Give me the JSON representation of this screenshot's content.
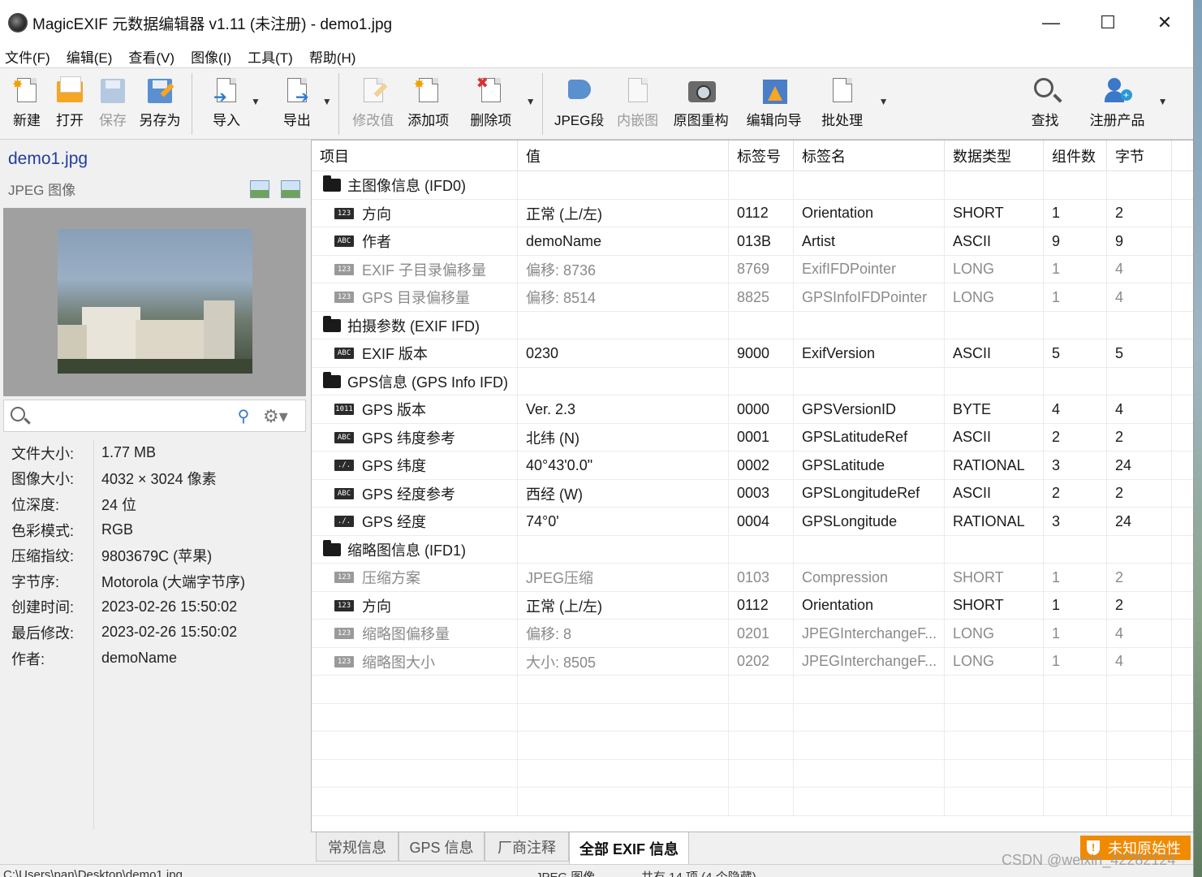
{
  "window": {
    "title": "MagicEXIF 元数据编辑器 v1.11 (未注册) - demo1.jpg",
    "minimize": "—",
    "maximize": "☐",
    "close": "✕"
  },
  "menu": [
    "文件(F)",
    "编辑(E)",
    "查看(V)",
    "图像(I)",
    "工具(T)",
    "帮助(H)"
  ],
  "toolbar": {
    "new": "新建",
    "open": "打开",
    "save": "保存",
    "save_as": "另存为",
    "import": "导入",
    "export": "导出",
    "edit_value": "修改值",
    "add_item": "添加项",
    "delete_item": "删除项",
    "jpeg_segment": "JPEG段",
    "embedded_image": "内嵌图",
    "rebuild": "原图重构",
    "edit_wizard": "编辑向导",
    "batch": "批处理",
    "find": "查找",
    "register": "注册产品"
  },
  "file_panel": {
    "file_name": "demo1.jpg",
    "file_type": "JPEG 图像",
    "search_placeholder": "",
    "info": [
      {
        "k": "文件大小:",
        "v": "1.77 MB"
      },
      {
        "k": "图像大小:",
        "v": "4032 × 3024 像素"
      },
      {
        "k": "位深度:",
        "v": "24 位"
      },
      {
        "k": "色彩模式:",
        "v": "RGB"
      },
      {
        "k": "压缩指纹:",
        "v": "9803679C (苹果)"
      },
      {
        "k": "字节序:",
        "v": "Motorola (大端字节序)"
      },
      {
        "k": "创建时间:",
        "v": "2023-02-26 15:50:02"
      },
      {
        "k": "最后修改:",
        "v": "2023-02-26 15:50:02"
      },
      {
        "k": "作者:",
        "v": "demoName"
      }
    ]
  },
  "grid": {
    "headers": [
      "项目",
      "值",
      "标签号",
      "标签名",
      "数据类型",
      "组件数",
      "字节"
    ],
    "rows": [
      {
        "group": true,
        "item": "主图像信息 (IFD0)"
      },
      {
        "badge": "123",
        "item": "方向",
        "value": "正常 (上/左)",
        "tag": "0112",
        "name": "Orientation",
        "dtype": "SHORT",
        "count": "1",
        "bytes": "2",
        "gray": false
      },
      {
        "badge": "ABC",
        "item": "作者",
        "value": "demoName",
        "tag": "013B",
        "name": "Artist",
        "dtype": "ASCII",
        "count": "9",
        "bytes": "9",
        "gray": false
      },
      {
        "badge": "123",
        "item": "EXIF 子目录偏移量",
        "value": "偏移: 8736",
        "tag": "8769",
        "name": "ExifIFDPointer",
        "dtype": "LONG",
        "count": "1",
        "bytes": "4",
        "gray": true
      },
      {
        "badge": "123",
        "item": "GPS 目录偏移量",
        "value": "偏移: 8514",
        "tag": "8825",
        "name": "GPSInfoIFDPointer",
        "dtype": "LONG",
        "count": "1",
        "bytes": "4",
        "gray": true
      },
      {
        "group": true,
        "item": "拍摄参数 (EXIF IFD)"
      },
      {
        "badge": "ABC",
        "item": "EXIF 版本",
        "value": "0230",
        "tag": "9000",
        "name": "ExifVersion",
        "dtype": "ASCII",
        "count": "5",
        "bytes": "5",
        "gray": false
      },
      {
        "group": true,
        "item": "GPS信息 (GPS Info IFD)"
      },
      {
        "badge": "1011",
        "item": "GPS 版本",
        "value": "Ver. 2.3",
        "tag": "0000",
        "name": "GPSVersionID",
        "dtype": "BYTE",
        "count": "4",
        "bytes": "4",
        "gray": false
      },
      {
        "badge": "ABC",
        "item": "GPS 纬度参考",
        "value": "北纬 (N)",
        "tag": "0001",
        "name": "GPSLatitudeRef",
        "dtype": "ASCII",
        "count": "2",
        "bytes": "2",
        "gray": false
      },
      {
        "badge": "./.",
        "item": "GPS 纬度",
        "value": "40°43'0.0\"",
        "tag": "0002",
        "name": "GPSLatitude",
        "dtype": "RATIONAL",
        "count": "3",
        "bytes": "24",
        "gray": false
      },
      {
        "badge": "ABC",
        "item": "GPS 经度参考",
        "value": "西经 (W)",
        "tag": "0003",
        "name": "GPSLongitudeRef",
        "dtype": "ASCII",
        "count": "2",
        "bytes": "2",
        "gray": false
      },
      {
        "badge": "./.",
        "item": "GPS 经度",
        "value": "74°0'",
        "tag": "0004",
        "name": "GPSLongitude",
        "dtype": "RATIONAL",
        "count": "3",
        "bytes": "24",
        "gray": false
      },
      {
        "group": true,
        "item": "缩略图信息 (IFD1)"
      },
      {
        "badge": "123",
        "item": "压缩方案",
        "value": "JPEG压缩",
        "tag": "0103",
        "name": "Compression",
        "dtype": "SHORT",
        "count": "1",
        "bytes": "2",
        "gray": true
      },
      {
        "badge": "123",
        "item": "方向",
        "value": "正常 (上/左)",
        "tag": "0112",
        "name": "Orientation",
        "dtype": "SHORT",
        "count": "1",
        "bytes": "2",
        "gray": false
      },
      {
        "badge": "123",
        "item": "缩略图偏移量",
        "value": "偏移: 8",
        "tag": "0201",
        "name": "JPEGInterchangeF...",
        "dtype": "LONG",
        "count": "1",
        "bytes": "4",
        "gray": true
      },
      {
        "badge": "123",
        "item": "缩略图大小",
        "value": "大小: 8505",
        "tag": "0202",
        "name": "JPEGInterchangeF...",
        "dtype": "LONG",
        "count": "1",
        "bytes": "4",
        "gray": true
      }
    ]
  },
  "tabs": [
    "常规信息",
    "GPS 信息",
    "厂商注释",
    "全部 EXIF 信息"
  ],
  "active_tab": "全部 EXIF 信息",
  "warning_badge": "未知原始性",
  "statusbar": {
    "path": "C:\\Users\\pan\\Desktop\\demo1.jpg",
    "type": "JPEG 图像",
    "count": "共有 14 项 (4 个隐藏)"
  },
  "watermark": "CSDN @weixin_42282124",
  "colors": {
    "accent": "#1f3f9c",
    "warning": "#f08a00"
  }
}
